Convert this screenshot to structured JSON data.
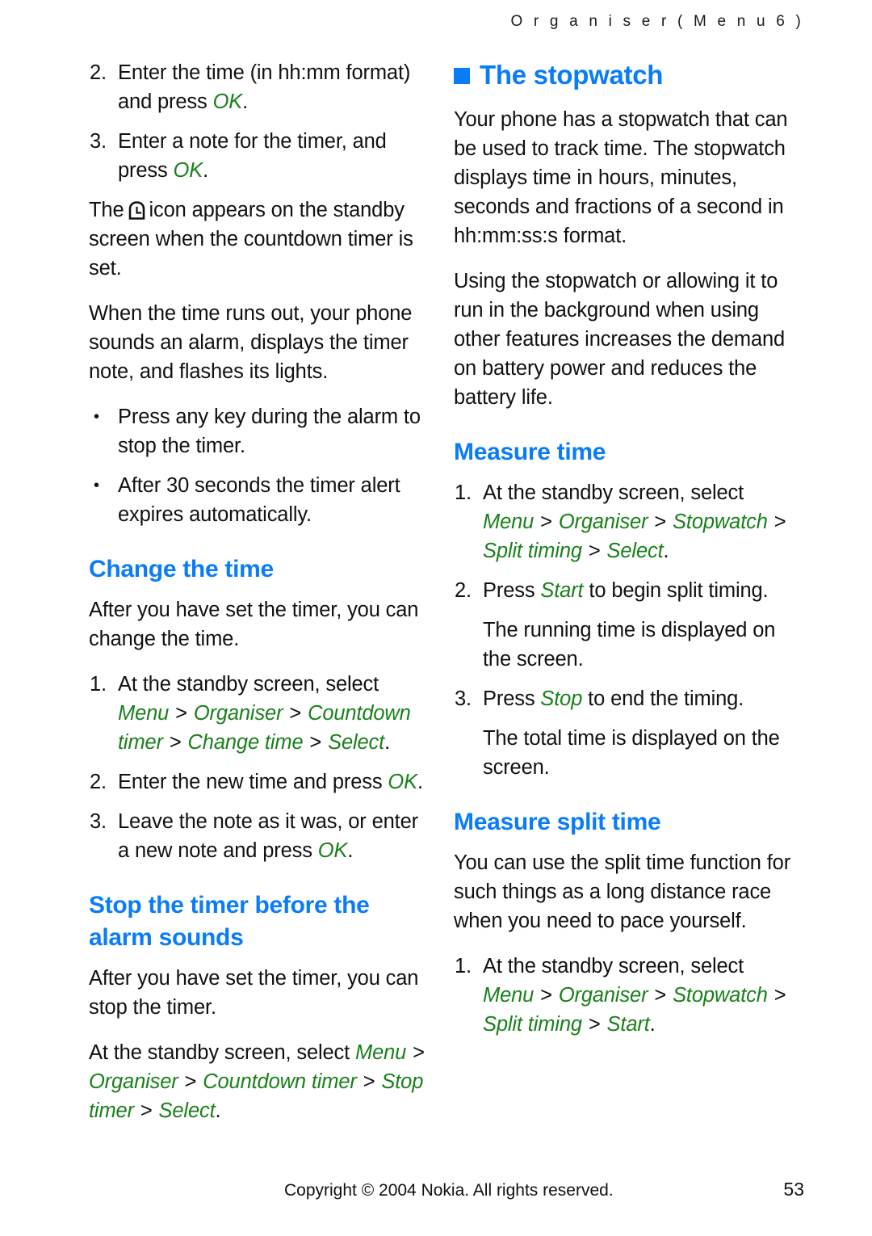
{
  "header": {
    "running_title": "O r g a n i s e r   ( M e n u   6 )"
  },
  "left_column": {
    "step2": {
      "num": "2.",
      "text_before": "Enter the time (in hh:mm format) and press ",
      "term": "OK",
      "text_after": "."
    },
    "step3": {
      "num": "3.",
      "text_before": "Enter a note for the timer, and press ",
      "term": "OK",
      "text_after": "."
    },
    "icon_para": {
      "before": "The",
      "icon": "countdown-timer-icon",
      "after": "icon appears on the standby screen when the countdown timer is set."
    },
    "alarm_para": "When the time runs out, your phone sounds an alarm, displays the timer note, and flashes its lights.",
    "bullet1": {
      "marker": "•",
      "text": "Press any key during the alarm to stop the timer."
    },
    "bullet2": {
      "marker": "•",
      "text": "After 30 seconds the timer alert expires automatically."
    },
    "change_time": {
      "heading": "Change the time",
      "intro": "After you have set the timer, you can change the time.",
      "step1": {
        "num": "1.",
        "lead": "At the standby screen, select ",
        "path": [
          "Menu",
          "Organiser",
          "Countdown timer",
          "Change time",
          "Select"
        ],
        "separator": ">",
        "period": "."
      },
      "step2": {
        "num": "2.",
        "text_before": "Enter the new time and press ",
        "term": "OK",
        "text_after": "."
      },
      "step3": {
        "num": "3.",
        "text_before": "Leave the note as it was, or enter a new note and press ",
        "term": "OK",
        "text_after": "."
      }
    },
    "stop_timer": {
      "heading": "Stop the timer before the alarm sounds",
      "intro": "After you have set the timer, you can stop the timer.",
      "path_para": {
        "lead": "At the standby screen, select ",
        "path": [
          "Menu",
          "Organiser",
          "Countdown timer",
          "Stop timer",
          "Select"
        ],
        "separator": ">",
        "period": "."
      }
    }
  },
  "right_column": {
    "chapter": {
      "bullet": "blue-square",
      "heading": "The stopwatch"
    },
    "intro1": "Your phone has a stopwatch that can be used to track time. The stopwatch displays time in hours, minutes, seconds and fractions of a second in hh:mm:ss:s format.",
    "intro2": "Using the stopwatch or allowing it to run in the background when using other features increases the demand on battery power and reduces the battery life.",
    "measure_time": {
      "heading": "Measure time",
      "step1": {
        "num": "1.",
        "lead": "At the standby screen, select ",
        "path": [
          "Menu",
          "Organiser",
          "Stopwatch",
          "Split timing",
          "Select"
        ],
        "separator": ">",
        "period": "."
      },
      "step2": {
        "num": "2.",
        "text_before": "Press ",
        "term": "Start",
        "text_after": " to begin split timing."
      },
      "step2_note": "The running time is displayed on the screen.",
      "step3": {
        "num": "3.",
        "text_before": "Press ",
        "term": "Stop",
        "text_after": " to end the timing."
      },
      "step3_note": "The total time is displayed on the screen."
    },
    "measure_split_time": {
      "heading": "Measure split time",
      "intro": "You can use the split time function for such things as a long distance race when you need to pace yourself.",
      "step1": {
        "num": "1.",
        "lead": "At the standby screen, select ",
        "path": [
          "Menu",
          "Organiser",
          "Stopwatch",
          "Split timing",
          "Start"
        ],
        "separator": ">",
        "period": "."
      }
    }
  },
  "footer": {
    "copyright": "Copyright © 2004 Nokia. All rights reserved.",
    "page_number": "53"
  },
  "colors": {
    "heading_blue": "#0a7cf7",
    "ui_term_green": "#19801a",
    "body_text": "#111111"
  }
}
